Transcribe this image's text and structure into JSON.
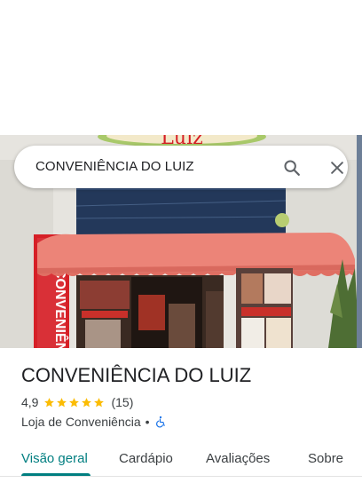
{
  "search": {
    "query": "CONVENIÊNCIA DO LUIZ"
  },
  "place": {
    "name": "CONVENIÊNCIA DO LUIZ",
    "rating": "4,9",
    "rating_stars": 5,
    "review_count": "(15)",
    "category": "Loja de Conveniência",
    "separator": "•"
  },
  "tabs": [
    {
      "label": "Visão geral",
      "active": true
    },
    {
      "label": "Cardápio",
      "active": false
    },
    {
      "label": "Avaliações",
      "active": false
    },
    {
      "label": "Sobre",
      "active": false
    }
  ],
  "photo": {
    "sign_text": "CONVENIÊN",
    "top_sign_text": "Luiz"
  },
  "colors": {
    "accent": "#007e80",
    "star": "#fbbc04",
    "awning": "#e8766c",
    "sign_red": "#d61f26"
  },
  "icons": {
    "search": "search-icon",
    "close": "close-icon",
    "star": "star-icon",
    "accessibility": "wheelchair-icon"
  }
}
